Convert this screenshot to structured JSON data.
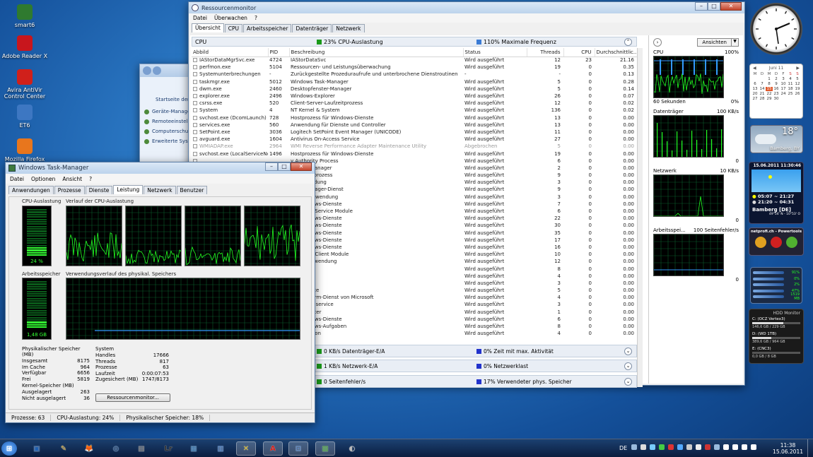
{
  "desktop_icons": [
    {
      "label": "smart6",
      "color": "#2f7a2f"
    },
    {
      "label": "Adobe Reader X",
      "color": "#c8161d"
    },
    {
      "label": "Avira AntiVir Control Center",
      "color": "#d0201b"
    },
    {
      "label": "ET6",
      "color": "#3d77c2"
    },
    {
      "label": "Mozilla Firefox",
      "color": "#e8761d"
    }
  ],
  "control_panel": {
    "header": "Startseite der S",
    "links": [
      "Geräte-Manage",
      "Remoteeinstell",
      "Computerschut",
      "Erweiterte Syst"
    ]
  },
  "resmon": {
    "title": "Ressourcenmonitor",
    "menu": [
      "Datei",
      "Überwachen",
      "?"
    ],
    "tabs": [
      "Übersicht",
      "CPU",
      "Arbeitsspeicher",
      "Datenträger",
      "Netzwerk"
    ],
    "cpu_header": {
      "title": "CPU",
      "usage": "23% CPU-Auslastung",
      "freq": "110% Maximale Frequenz",
      "usage_color": "#1a9a1a",
      "freq_color": "#3a7bd5"
    },
    "columns": [
      "Abbild",
      "PID",
      "Beschreibung",
      "Status",
      "Threads",
      "CPU",
      "Durchschnittlic..."
    ],
    "rows": [
      [
        "IAStorDataMgrSvc.exe",
        "4724",
        "IAStorDataSvc",
        "Wird ausgeführt",
        "12",
        "23",
        "21.16"
      ],
      [
        "perfmon.exe",
        "5104",
        "Ressourcen- und Leistungsüberwachung",
        "Wird ausgeführt",
        "19",
        "0",
        "0.35"
      ],
      [
        "Systemunterbrechungen",
        "-",
        "Zurückgestellte Prozeduraufrufe und unterbrochene Dienstroutinen",
        "-",
        "-",
        "0",
        "0.13"
      ],
      [
        "taskmgr.exe",
        "5012",
        "Windows Task-Manager",
        "Wird ausgeführt",
        "5",
        "0",
        "0.28"
      ],
      [
        "dwm.exe",
        "2460",
        "Desktopfenster-Manager",
        "Wird ausgeführt",
        "5",
        "0",
        "0.14"
      ],
      [
        "explorer.exe",
        "2496",
        "Windows-Explorer",
        "Wird ausgeführt",
        "26",
        "0",
        "0.07"
      ],
      [
        "csrss.exe",
        "520",
        "Client-Server-Laufzeitprozess",
        "Wird ausgeführt",
        "12",
        "0",
        "0.02"
      ],
      [
        "System",
        "4",
        "NT Kernel & System",
        "Wird ausgeführt",
        "136",
        "0",
        "0.02"
      ],
      [
        "svchost.exe (DcomLaunch)",
        "728",
        "Hostprozess für Windows-Dienste",
        "Wird ausgeführt",
        "13",
        "0",
        "0.00"
      ],
      [
        "services.exe",
        "560",
        "Anwendung für Dienste und Controller",
        "Wird ausgeführt",
        "13",
        "0",
        "0.00"
      ],
      [
        "SetPoint.exe",
        "3036",
        "Logitech SetPoint Event Manager (UNICODE)",
        "Wird ausgeführt",
        "11",
        "0",
        "0.00"
      ],
      [
        "avguard.exe",
        "1604",
        "Antivirus On-Access Service",
        "Wird ausgeführt",
        "27",
        "0",
        "0.00"
      ],
      [
        "WMIADAP.exe",
        "2964",
        "WMI Reverse Performance Adapter Maintenance Utility",
        "Abgebrochen",
        "5",
        "0",
        "0.00"
      ],
      [
        "svchost.exe (LocalServiceNo...",
        "1496",
        "Hostprozess für Windows-Dienste",
        "Wird ausgeführt",
        "19",
        "0",
        "0.00"
      ],
      [
        "",
        "",
        "y Authority Process",
        "Wird ausgeführt",
        "6",
        "0",
        "0.00"
      ],
      [
        "",
        "",
        "itzungs-Manager",
        "Wird ausgeführt",
        "2",
        "0",
        "0.00"
      ],
      [
        "",
        "",
        "r-Laufzeitprozess",
        "Wird ausgeführt",
        "9",
        "0",
        "0.00"
      ],
      [
        "",
        "",
        "artanwendung",
        "Wird ausgeführt",
        "3",
        "0",
        "0.00"
      ],
      [
        "",
        "",
        "ungs-Manager-Dienst",
        "Wird ausgeführt",
        "9",
        "0",
        "0.00"
      ],
      [
        "",
        "",
        "nmeldeanwendung",
        "Wird ausgeführt",
        "3",
        "0",
        "0.00"
      ],
      [
        "",
        "",
        "für Windows-Dienste",
        "Wird ausgeführt",
        "7",
        "0",
        "0.00"
      ],
      [
        "",
        "",
        "al Events Service Module",
        "Wird ausgeführt",
        "6",
        "0",
        "0.00"
      ],
      [
        "",
        "",
        "für Windows-Dienste",
        "Wird ausgeführt",
        "22",
        "0",
        "0.00"
      ],
      [
        "",
        "",
        "für Windows-Dienste",
        "Wird ausgeführt",
        "30",
        "0",
        "0.00"
      ],
      [
        "",
        "",
        "für Windows-Dienste",
        "Wird ausgeführt",
        "35",
        "0",
        "0.00"
      ],
      [
        "",
        "",
        "für Windows-Dienste",
        "Wird ausgeführt",
        "17",
        "0",
        "0.00"
      ],
      [
        "",
        "",
        "für Windows-Dienste",
        "Wird ausgeführt",
        "16",
        "0",
        "0.00"
      ],
      [
        "",
        "",
        "al Events Client Module",
        "Wird ausgeführt",
        "10",
        "0",
        "0.00"
      ],
      [
        "",
        "",
        "ystem-Anwendung",
        "Wird ausgeführt",
        "12",
        "0",
        "0.00"
      ],
      [
        "",
        "",
        "neduler",
        "Wird ausgeführt",
        "8",
        "0",
        "0.00"
      ],
      [
        "",
        "",
        "",
        "Wird ausgeführt",
        "4",
        "0",
        "0.00"
      ],
      [
        "",
        "",
        "rvice",
        "Wird ausgeführt",
        "3",
        "0",
        "0.00"
      ],
      [
        "",
        "",
        "ock Service",
        "Wird ausgeführt",
        "5",
        "0",
        "0.00"
      ],
      [
        "",
        "",
        "utzplattform-Dienst von Microsoft",
        "Wird ausgeführt",
        "4",
        "0",
        "0.00"
      ],
      [
        "",
        "",
        "dow copy service",
        "Wird ausgeführt",
        "3",
        "0",
        "0.00"
      ],
      [
        "",
        "",
        "solenfenster",
        "Wird ausgeführt",
        "1",
        "0",
        "0.00"
      ],
      [
        "",
        "",
        "für Windows-Dienste",
        "Wird ausgeführt",
        "6",
        "0",
        "0.00"
      ],
      [
        "",
        "",
        "für Windows-Aufgaben",
        "Wird ausgeführt",
        "8",
        "0",
        "0.00"
      ],
      [
        "",
        "",
        "rev Daemon",
        "Wird ausgeführt",
        "4",
        "0",
        "0.00"
      ]
    ],
    "sections": [
      {
        "title": "Datenträger",
        "left": "0 KB/s Datenträger-E/A",
        "right": "0% Zeit mit max. Aktivität"
      },
      {
        "title": "Netzwerk",
        "left": "1 KB/s Netzwerk-E/A",
        "right": "0% Netzwerklast"
      },
      {
        "title": "Arbeitsspeicher",
        "left": "0 Seitenfehler/s",
        "right": "17% Verwendeter phys. Speicher"
      }
    ],
    "view_button": "Ansichten",
    "graphs": [
      {
        "title": "CPU",
        "max": "100%",
        "footer_left": "60 Sekunden",
        "footer_right": "0%"
      },
      {
        "title": "Datenträger",
        "max": "100 KB/s",
        "footer_left": "",
        "footer_right": "0"
      },
      {
        "title": "Netzwerk",
        "max": "10 KB/s",
        "footer_left": "",
        "footer_right": "0"
      },
      {
        "title": "Arbeitsspei...",
        "max": "100 Seitenfehler/s",
        "footer_left": "",
        "footer_right": "0"
      }
    ]
  },
  "taskmgr": {
    "title": "Windows Task-Manager",
    "menu": [
      "Datei",
      "Optionen",
      "Ansicht",
      "?"
    ],
    "tabs": [
      "Anwendungen",
      "Prozesse",
      "Dienste",
      "Leistung",
      "Netzwerk",
      "Benutzer"
    ],
    "cpu_usage_title": "CPU-Auslastung",
    "cpu_history_title": "Verlauf der CPU-Auslastung",
    "cpu_usage_value": "24 %",
    "cpu_usage_fraction": 0.24,
    "mem_title": "Arbeitsspeicher",
    "mem_history_title": "Verwendungsverlauf des physikal. Speichers",
    "mem_value": "1,48 GB",
    "mem_fraction": 0.18,
    "physical": {
      "title": "Physikalischer Speicher (MB)",
      "rows": [
        [
          "Insgesamt",
          "8175"
        ],
        [
          "Im Cache",
          "964"
        ],
        [
          "Verfügbar",
          "6656"
        ],
        [
          "Frei",
          "5819"
        ]
      ]
    },
    "system": {
      "title": "System",
      "rows": [
        [
          "Handles",
          "17666"
        ],
        [
          "Threads",
          "817"
        ],
        [
          "Prozesse",
          "63"
        ],
        [
          "Laufzeit",
          "0:00:07:53"
        ],
        [
          "Zugesichert (MB)",
          "1747/8173"
        ]
      ]
    },
    "kernel": {
      "title": "Kernel-Speicher (MB)",
      "rows": [
        [
          "Ausgelagert",
          "263"
        ],
        [
          "Nicht ausgelagert",
          "36"
        ]
      ]
    },
    "resmon_button": "Ressourcenmonitor...",
    "status": [
      "Prozesse: 63",
      "CPU-Auslastung: 24%",
      "Physikalischer Speicher: 18%"
    ]
  },
  "gadgets": {
    "calendar": {
      "month": "Juni 11",
      "weekdays": [
        "M",
        "D",
        "M",
        "D",
        "F",
        "S",
        "S"
      ],
      "days": [
        "",
        "",
        "1",
        "2",
        "3",
        "4",
        "5",
        "6",
        "7",
        "8",
        "9",
        "10",
        "11",
        "12",
        "13",
        "14",
        "15",
        "16",
        "17",
        "18",
        "19",
        "20",
        "21",
        "22",
        "23",
        "24",
        "25",
        "26",
        "27",
        "28",
        "29",
        "30",
        "",
        "",
        ""
      ],
      "today": "15"
    },
    "weather": {
      "temp": "18°",
      "place": "Bamberg, BY"
    },
    "sun": {
      "date": "15.06.2011 11:30:46",
      "rise": "05:07 ~ 21:27",
      "moon": "21:20 ~ 04:31",
      "city": "Bamberg [DE]",
      "coords": "49°54' N - 10°53' O"
    },
    "powertools": {
      "title": "netprofi.ch - Powertools"
    },
    "meter": {
      "values": [
        "91%",
        "0%",
        "2%",
        "47%",
        "1519 MB"
      ]
    },
    "hdd": {
      "title": "HDD Monitor",
      "drives": [
        [
          "C: (OCZ Vertex3)",
          "146,6 GB / 229 GB"
        ],
        [
          "D: (WD 1TB)",
          "389,6 GB / 964 GB"
        ],
        [
          "E: (CNC3)",
          "0,0 GB / 8 GB"
        ]
      ]
    }
  },
  "taskbar": {
    "apps": [
      "⊞",
      "▣",
      "✎",
      "🦊",
      "◎",
      "▤",
      "Lr",
      "▦",
      "▥",
      "✕",
      "A",
      "⊡",
      "▩",
      "◐"
    ],
    "lang": "DE",
    "time": "11:38",
    "date": "15.06.2011"
  }
}
